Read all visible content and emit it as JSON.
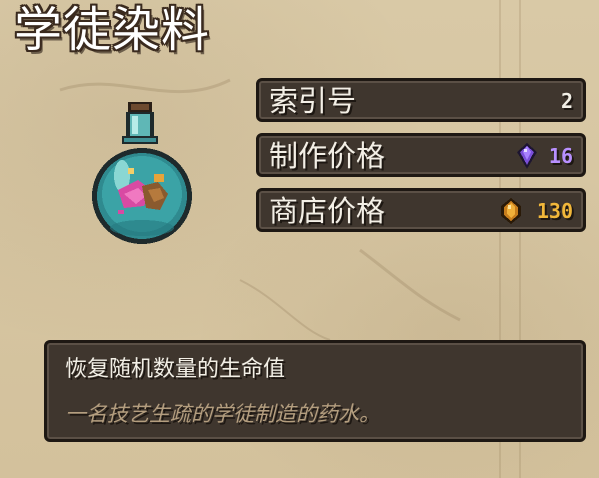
{
  "item": {
    "name": "学徒染料",
    "description": "恢复随机数量的生命值",
    "flavor_text": "一名技艺生疏的学徒制造的药水。"
  },
  "stats": [
    {
      "label": "索引号",
      "value": "2",
      "icon": null
    },
    {
      "label": "制作价格",
      "value": "16",
      "icon": "purple-gem-icon"
    },
    {
      "label": "商店价格",
      "value": "130",
      "icon": "gold-coin-icon"
    }
  ],
  "colors": {
    "panel": "#3f362e",
    "parchment": "#d7c7a4",
    "crafting_value": "#b890ff",
    "shop_value": "#f1b73a",
    "flavor_text": "#b49e7f"
  },
  "icons": {
    "potion": "teal-potion-flask-icon"
  }
}
